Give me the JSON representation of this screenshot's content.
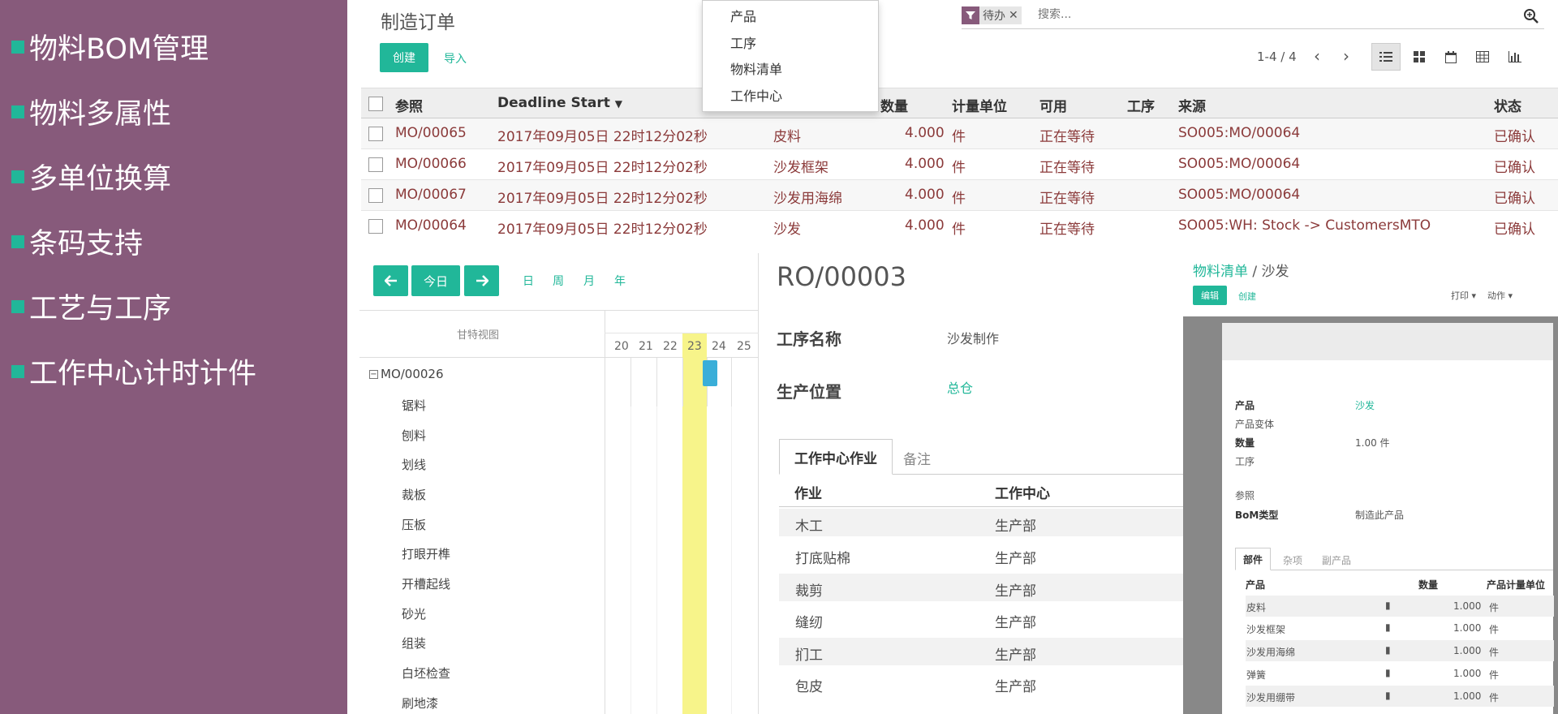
{
  "sidebar": {
    "features": [
      "物料BOM管理",
      "物料多属性",
      "多单位换算",
      "条码支持",
      "工艺与工序",
      "工作中心计时计件"
    ]
  },
  "mo_list": {
    "title": "制造订单",
    "create_label": "创建",
    "import_label": "导入",
    "pager": "1-4 / 4",
    "search_facet": "待办",
    "search_placeholder": "搜索...",
    "dropdown": [
      "产品",
      "工序",
      "物料清单",
      "工作中心"
    ],
    "columns": {
      "ref": "参照",
      "deadline": "Deadline Start",
      "qty": "数量",
      "uom": "计量单位",
      "avail": "可用",
      "routing": "工序",
      "origin": "来源",
      "state": "状态"
    },
    "rows": [
      {
        "ref": "MO/00065",
        "date": "2017年09月05日 22时12分02秒",
        "product": "皮料",
        "qty": "4.000",
        "uom": "件",
        "avail": "正在等待",
        "origin": "SO005:MO/00064",
        "state": "已确认"
      },
      {
        "ref": "MO/00066",
        "date": "2017年09月05日 22时12分02秒",
        "product": "沙发框架",
        "qty": "4.000",
        "uom": "件",
        "avail": "正在等待",
        "origin": "SO005:MO/00064",
        "state": "已确认"
      },
      {
        "ref": "MO/00067",
        "date": "2017年09月05日 22时12分02秒",
        "product": "沙发用海绵",
        "qty": "4.000",
        "uom": "件",
        "avail": "正在等待",
        "origin": "SO005:MO/00064",
        "state": "已确认"
      },
      {
        "ref": "MO/00064",
        "date": "2017年09月05日 22时12分02秒",
        "product": "沙发",
        "qty": "4.000",
        "uom": "件",
        "avail": "正在等待",
        "origin": "SO005:WH: Stock -> CustomersMTO",
        "state": "已确认"
      }
    ]
  },
  "gantt": {
    "today_label": "今日",
    "scales": [
      "日",
      "周",
      "月",
      "年"
    ],
    "view_label": "甘特视图",
    "days": [
      "20",
      "21",
      "22",
      "23",
      "24",
      "25"
    ],
    "today_index": 3,
    "group": "MO/00026",
    "tasks": [
      "锯料",
      "刨料",
      "划线",
      "裁板",
      "压板",
      "打眼开榫",
      "开槽起线",
      "砂光",
      "组装",
      "白坯检查",
      "刷地漆"
    ]
  },
  "routing": {
    "title": "RO/00003",
    "name_label": "工序名称",
    "name_value": "沙发制作",
    "location_label": "生产位置",
    "location_value": "总仓",
    "tabs": [
      "工作中心作业",
      "备注"
    ],
    "col_op": "作业",
    "col_wc": "工作中心",
    "ops": [
      {
        "op": "木工",
        "wc": "生产部"
      },
      {
        "op": "打底贴棉",
        "wc": "生产部"
      },
      {
        "op": "裁剪",
        "wc": "生产部"
      },
      {
        "op": "缝纫",
        "wc": "生产部"
      },
      {
        "op": "扪工",
        "wc": "生产部"
      },
      {
        "op": "包皮",
        "wc": "生产部"
      }
    ]
  },
  "bom": {
    "breadcrumb_parent": "物料清单",
    "breadcrumb_sep": "/",
    "breadcrumb_current": "沙发",
    "edit_label": "编辑",
    "create_label": "创建",
    "print_label": "打印 ▾",
    "action_label": "动作 ▾",
    "product_label": "产品",
    "product_value": "沙发",
    "variant_label": "产品变体",
    "qty_label": "数量",
    "qty_value": "1.00 件",
    "routing_label": "工序",
    "ref_label": "参照",
    "type_label": "BoM类型",
    "type_value": "制造此产品",
    "tabs": [
      "部件",
      "杂项",
      "副产品"
    ],
    "col_product": "产品",
    "col_qty": "数量",
    "col_uom": "产品计量单位",
    "lines": [
      {
        "product": "皮料",
        "qty": "1.000",
        "uom": "件"
      },
      {
        "product": "沙发框架",
        "qty": "1.000",
        "uom": "件"
      },
      {
        "product": "沙发用海绵",
        "qty": "1.000",
        "uom": "件"
      },
      {
        "product": "弹簧",
        "qty": "1.000",
        "uom": "件"
      },
      {
        "product": "沙发用绷带",
        "qty": "1.000",
        "uom": "件"
      }
    ]
  },
  "colors": {
    "sidebar": "#875a7b",
    "accent": "#21b799",
    "row_text": "#8b3a3a",
    "today": "#f7f48a"
  }
}
